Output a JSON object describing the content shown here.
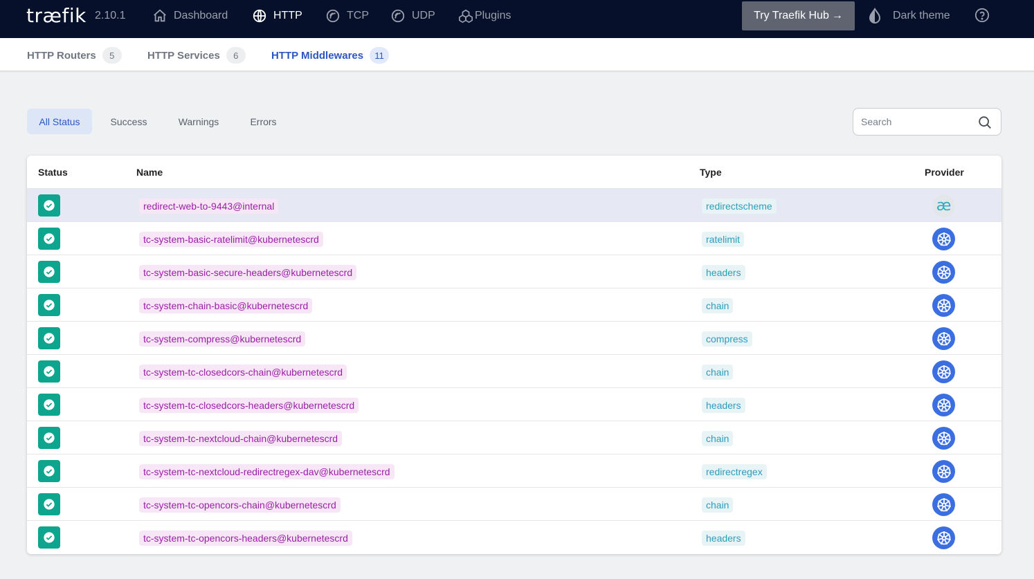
{
  "brand": {
    "logo": "træfik",
    "version": "2.10.1"
  },
  "nav": {
    "dashboard": "Dashboard",
    "http": "HTTP",
    "tcp": "TCP",
    "udp": "UDP",
    "plugins": "Plugins",
    "hub_button": "Try Traefik Hub",
    "hub_arrow": "→",
    "theme": "Dark theme",
    "active": "HTTP"
  },
  "tabs": [
    {
      "label": "HTTP Routers",
      "count": "5"
    },
    {
      "label": "HTTP Services",
      "count": "6"
    },
    {
      "label": "HTTP Middlewares",
      "count": "11"
    }
  ],
  "active_tab": "HTTP Middlewares",
  "filters": {
    "all": "All Status",
    "success": "Success",
    "warnings": "Warnings",
    "errors": "Errors",
    "active": "All Status"
  },
  "search": {
    "placeholder": "Search"
  },
  "table": {
    "headers": {
      "status": "Status",
      "name": "Name",
      "type": "Type",
      "provider": "Provider"
    },
    "rows": [
      {
        "status": "success",
        "name": "redirect-web-to-9443@internal",
        "type": "redirectscheme",
        "provider": "internal"
      },
      {
        "status": "success",
        "name": "tc-system-basic-ratelimit@kubernetescrd",
        "type": "ratelimit",
        "provider": "kubernetescrd"
      },
      {
        "status": "success",
        "name": "tc-system-basic-secure-headers@kubernetescrd",
        "type": "headers",
        "provider": "kubernetescrd"
      },
      {
        "status": "success",
        "name": "tc-system-chain-basic@kubernetescrd",
        "type": "chain",
        "provider": "kubernetescrd"
      },
      {
        "status": "success",
        "name": "tc-system-compress@kubernetescrd",
        "type": "compress",
        "provider": "kubernetescrd"
      },
      {
        "status": "success",
        "name": "tc-system-tc-closedcors-chain@kubernetescrd",
        "type": "chain",
        "provider": "kubernetescrd"
      },
      {
        "status": "success",
        "name": "tc-system-tc-closedcors-headers@kubernetescrd",
        "type": "headers",
        "provider": "kubernetescrd"
      },
      {
        "status": "success",
        "name": "tc-system-tc-nextcloud-chain@kubernetescrd",
        "type": "chain",
        "provider": "kubernetescrd"
      },
      {
        "status": "success",
        "name": "tc-system-tc-nextcloud-redirectregex-dav@kubernetescrd",
        "type": "redirectregex",
        "provider": "kubernetescrd"
      },
      {
        "status": "success",
        "name": "tc-system-tc-opencors-chain@kubernetescrd",
        "type": "chain",
        "provider": "kubernetescrd"
      },
      {
        "status": "success",
        "name": "tc-system-tc-opencors-headers@kubernetescrd",
        "type": "headers",
        "provider": "kubernetescrd"
      }
    ],
    "internal_provider_glyph": "æ"
  },
  "colors": {
    "nav_bg": "#06102a",
    "accent": "#2b56c4",
    "success": "#0ea58f",
    "name_chip_text": "#9b1fa6",
    "type_chip_text": "#2c9dbb",
    "kubernetes": "#3b6ee0"
  }
}
